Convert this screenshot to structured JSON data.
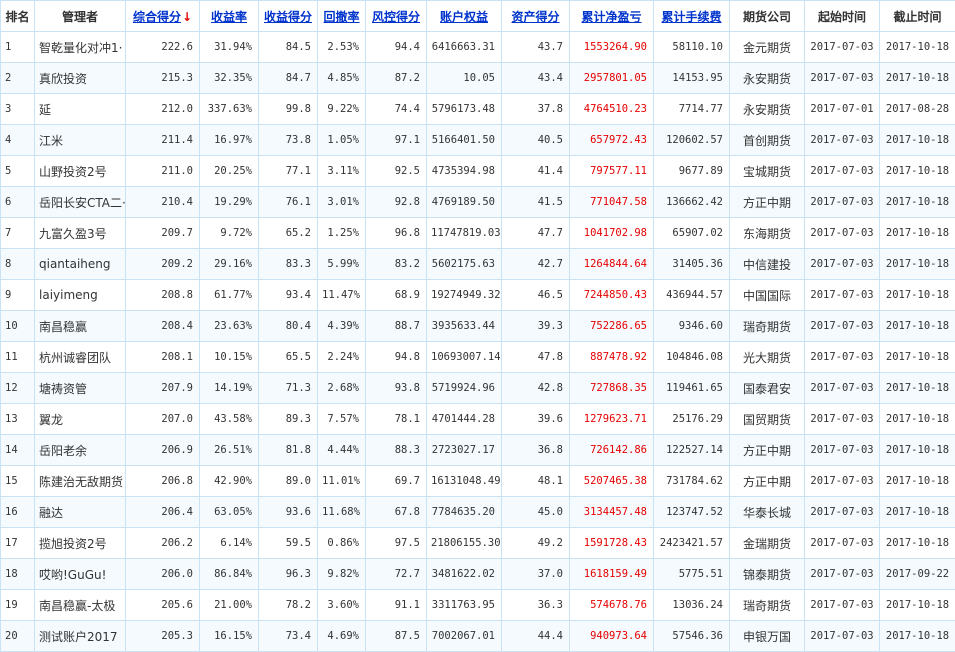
{
  "header": {
    "rank": "排名",
    "manager": "管理者",
    "score": "综合得分",
    "sort_arrow": "↓",
    "return_rate": "收益率",
    "return_score": "收益得分",
    "drawdown": "回撤率",
    "risk_score": "风控得分",
    "equity": "账户权益",
    "asset_score": "资产得分",
    "net_profit": "累计净盈亏",
    "fees": "累计手续费",
    "company": "期货公司",
    "start": "起始时间",
    "end": "截止时间"
  },
  "colors": {
    "link": "#0033cc",
    "profit_red": "#e60000",
    "border": "#c9e3f4",
    "stripe": "#f4fafe"
  },
  "rows": [
    {
      "rank": "1",
      "manager": "智乾量化对冲1·",
      "score": "222.6",
      "return_rate": "31.94%",
      "return_score": "84.5",
      "drawdown": "2.53%",
      "risk_score": "94.4",
      "equity": "6416663.31",
      "asset_score": "43.7",
      "net_profit": "1553264.90",
      "fees": "58110.10",
      "company": "金元期货",
      "start": "2017-07-03",
      "end": "2017-10-18"
    },
    {
      "rank": "2",
      "manager": "真欣投资",
      "score": "215.3",
      "return_rate": "32.35%",
      "return_score": "84.7",
      "drawdown": "4.85%",
      "risk_score": "87.2",
      "equity": "10.05",
      "asset_score": "43.4",
      "net_profit": "2957801.05",
      "fees": "14153.95",
      "company": "永安期货",
      "start": "2017-07-03",
      "end": "2017-10-18"
    },
    {
      "rank": "3",
      "manager": "延",
      "score": "212.0",
      "return_rate": "337.63%",
      "return_score": "99.8",
      "drawdown": "9.22%",
      "risk_score": "74.4",
      "equity": "5796173.48",
      "asset_score": "37.8",
      "net_profit": "4764510.23",
      "fees": "7714.77",
      "company": "永安期货",
      "start": "2017-07-01",
      "end": "2017-08-28"
    },
    {
      "rank": "4",
      "manager": "江米",
      "score": "211.4",
      "return_rate": "16.97%",
      "return_score": "73.8",
      "drawdown": "1.05%",
      "risk_score": "97.1",
      "equity": "5166401.50",
      "asset_score": "40.5",
      "net_profit": "657972.43",
      "fees": "120602.57",
      "company": "首创期货",
      "start": "2017-07-03",
      "end": "2017-10-18"
    },
    {
      "rank": "5",
      "manager": "山野投资2号",
      "score": "211.0",
      "return_rate": "20.25%",
      "return_score": "77.1",
      "drawdown": "3.11%",
      "risk_score": "92.5",
      "equity": "4735394.98",
      "asset_score": "41.4",
      "net_profit": "797577.11",
      "fees": "9677.89",
      "company": "宝城期货",
      "start": "2017-07-03",
      "end": "2017-10-18"
    },
    {
      "rank": "6",
      "manager": "岳阳长安CTA二·",
      "score": "210.4",
      "return_rate": "19.29%",
      "return_score": "76.1",
      "drawdown": "3.01%",
      "risk_score": "92.8",
      "equity": "4769189.50",
      "asset_score": "41.5",
      "net_profit": "771047.58",
      "fees": "136662.42",
      "company": "方正中期",
      "start": "2017-07-03",
      "end": "2017-10-18"
    },
    {
      "rank": "7",
      "manager": "九富久盈3号",
      "score": "209.7",
      "return_rate": "9.72%",
      "return_score": "65.2",
      "drawdown": "1.25%",
      "risk_score": "96.8",
      "equity": "11747819.03",
      "asset_score": "47.7",
      "net_profit": "1041702.98",
      "fees": "65907.02",
      "company": "东海期货",
      "start": "2017-07-03",
      "end": "2017-10-18"
    },
    {
      "rank": "8",
      "manager": "qiantaiheng",
      "score": "209.2",
      "return_rate": "29.16%",
      "return_score": "83.3",
      "drawdown": "5.99%",
      "risk_score": "83.2",
      "equity": "5602175.63",
      "asset_score": "42.7",
      "net_profit": "1264844.64",
      "fees": "31405.36",
      "company": "中信建投",
      "start": "2017-07-03",
      "end": "2017-10-18"
    },
    {
      "rank": "9",
      "manager": "laiyimeng",
      "score": "208.8",
      "return_rate": "61.77%",
      "return_score": "93.4",
      "drawdown": "11.47%",
      "risk_score": "68.9",
      "equity": "19274949.32",
      "asset_score": "46.5",
      "net_profit": "7244850.43",
      "fees": "436944.57",
      "company": "中国国际",
      "start": "2017-07-03",
      "end": "2017-10-18"
    },
    {
      "rank": "10",
      "manager": "南昌稳赢",
      "score": "208.4",
      "return_rate": "23.63%",
      "return_score": "80.4",
      "drawdown": "4.39%",
      "risk_score": "88.7",
      "equity": "3935633.44",
      "asset_score": "39.3",
      "net_profit": "752286.65",
      "fees": "9346.60",
      "company": "瑞奇期货",
      "start": "2017-07-03",
      "end": "2017-10-18"
    },
    {
      "rank": "11",
      "manager": "杭州诚睿团队",
      "score": "208.1",
      "return_rate": "10.15%",
      "return_score": "65.5",
      "drawdown": "2.24%",
      "risk_score": "94.8",
      "equity": "10693007.14",
      "asset_score": "47.8",
      "net_profit": "887478.92",
      "fees": "104846.08",
      "company": "光大期货",
      "start": "2017-07-03",
      "end": "2017-10-18"
    },
    {
      "rank": "12",
      "manager": "塘祷资管",
      "score": "207.9",
      "return_rate": "14.19%",
      "return_score": "71.3",
      "drawdown": "2.68%",
      "risk_score": "93.8",
      "equity": "5719924.96",
      "asset_score": "42.8",
      "net_profit": "727868.35",
      "fees": "119461.65",
      "company": "国泰君安",
      "start": "2017-07-03",
      "end": "2017-10-18"
    },
    {
      "rank": "13",
      "manager": "翼龙",
      "score": "207.0",
      "return_rate": "43.58%",
      "return_score": "89.3",
      "drawdown": "7.57%",
      "risk_score": "78.1",
      "equity": "4701444.28",
      "asset_score": "39.6",
      "net_profit": "1279623.71",
      "fees": "25176.29",
      "company": "国贸期货",
      "start": "2017-07-03",
      "end": "2017-10-18"
    },
    {
      "rank": "14",
      "manager": "岳阳老余",
      "score": "206.9",
      "return_rate": "26.51%",
      "return_score": "81.8",
      "drawdown": "4.44%",
      "risk_score": "88.3",
      "equity": "2723027.17",
      "asset_score": "36.8",
      "net_profit": "726142.86",
      "fees": "122527.14",
      "company": "方正中期",
      "start": "2017-07-03",
      "end": "2017-10-18"
    },
    {
      "rank": "15",
      "manager": "陈建治无敌期货",
      "score": "206.8",
      "return_rate": "42.90%",
      "return_score": "89.0",
      "drawdown": "11.01%",
      "risk_score": "69.7",
      "equity": "16131048.49",
      "asset_score": "48.1",
      "net_profit": "5207465.38",
      "fees": "731784.62",
      "company": "方正中期",
      "start": "2017-07-03",
      "end": "2017-10-18"
    },
    {
      "rank": "16",
      "manager": "融达",
      "score": "206.4",
      "return_rate": "63.05%",
      "return_score": "93.6",
      "drawdown": "11.68%",
      "risk_score": "67.8",
      "equity": "7784635.20",
      "asset_score": "45.0",
      "net_profit": "3134457.48",
      "fees": "123747.52",
      "company": "华泰长城",
      "start": "2017-07-03",
      "end": "2017-10-18"
    },
    {
      "rank": "17",
      "manager": "揽旭投资2号",
      "score": "206.2",
      "return_rate": "6.14%",
      "return_score": "59.5",
      "drawdown": "0.86%",
      "risk_score": "97.5",
      "equity": "21806155.30",
      "asset_score": "49.2",
      "net_profit": "1591728.43",
      "fees": "2423421.57",
      "company": "金瑞期货",
      "start": "2017-07-03",
      "end": "2017-10-18"
    },
    {
      "rank": "18",
      "manager": "哎哟!GuGu!",
      "score": "206.0",
      "return_rate": "86.84%",
      "return_score": "96.3",
      "drawdown": "9.82%",
      "risk_score": "72.7",
      "equity": "3481622.02",
      "asset_score": "37.0",
      "net_profit": "1618159.49",
      "fees": "5775.51",
      "company": "锦泰期货",
      "start": "2017-07-03",
      "end": "2017-09-22"
    },
    {
      "rank": "19",
      "manager": "南昌稳赢-太极",
      "score": "205.6",
      "return_rate": "21.00%",
      "return_score": "78.2",
      "drawdown": "3.60%",
      "risk_score": "91.1",
      "equity": "3311763.95",
      "asset_score": "36.3",
      "net_profit": "574678.76",
      "fees": "13036.24",
      "company": "瑞奇期货",
      "start": "2017-07-03",
      "end": "2017-10-18"
    },
    {
      "rank": "20",
      "manager": "测试账户2017",
      "score": "205.3",
      "return_rate": "16.15%",
      "return_score": "73.4",
      "drawdown": "4.69%",
      "risk_score": "87.5",
      "equity": "7002067.01",
      "asset_score": "44.4",
      "net_profit": "940973.64",
      "fees": "57546.36",
      "company": "申银万国",
      "start": "2017-07-03",
      "end": "2017-10-18"
    }
  ]
}
